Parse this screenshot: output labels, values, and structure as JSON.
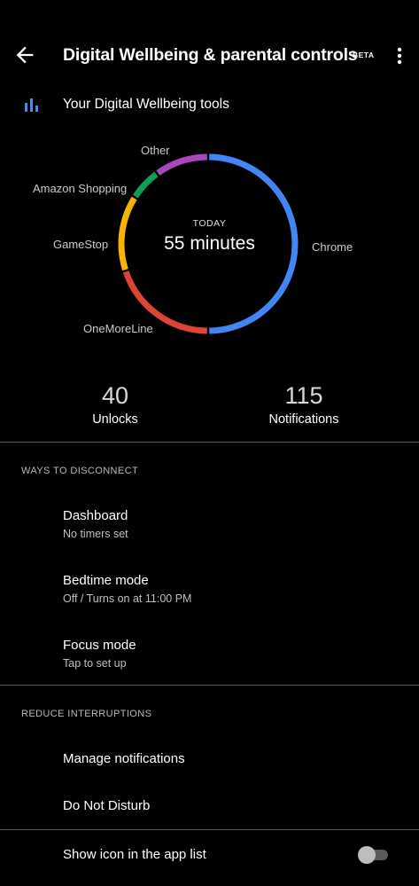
{
  "header": {
    "title": "Digital Wellbeing & parental controls",
    "beta": "BETA",
    "back_icon": "arrow-back-icon",
    "more_icon": "more-vert-icon"
  },
  "tools": {
    "title": "Your Digital Wellbeing tools",
    "icon": "bar-chart-icon",
    "icon_color": "#4f86ec"
  },
  "chart_data": {
    "type": "pie",
    "style": "donut",
    "center_label": "TODAY",
    "center_value": "55 minutes",
    "slices": [
      {
        "label": "Chrome",
        "percent": 50,
        "color": "#4285f4"
      },
      {
        "label": "OneMoreLine",
        "percent": 20,
        "color": "#db4437"
      },
      {
        "label": "GameStop",
        "percent": 14,
        "color": "#f4b400"
      },
      {
        "label": "Amazon Shopping",
        "percent": 6,
        "color": "#0f9d58"
      },
      {
        "label": "Other",
        "percent": 10,
        "color": "#ab47bc"
      }
    ]
  },
  "stats": {
    "unlocks_value": "40",
    "unlocks_label": "Unlocks",
    "notifications_value": "115",
    "notifications_label": "Notifications"
  },
  "disconnect": {
    "header": "WAYS TO DISCONNECT",
    "items": [
      {
        "title": "Dashboard",
        "subtitle": "No timers set"
      },
      {
        "title": "Bedtime mode",
        "subtitle": "Off / Turns on at 11:00 PM"
      },
      {
        "title": "Focus mode",
        "subtitle": "Tap to set up"
      }
    ]
  },
  "interruptions": {
    "header": "REDUCE INTERRUPTIONS",
    "items": [
      {
        "title": "Manage notifications"
      },
      {
        "title": "Do Not Disturb"
      }
    ]
  },
  "show_icon": {
    "label": "Show icon in the app list",
    "enabled": false
  }
}
